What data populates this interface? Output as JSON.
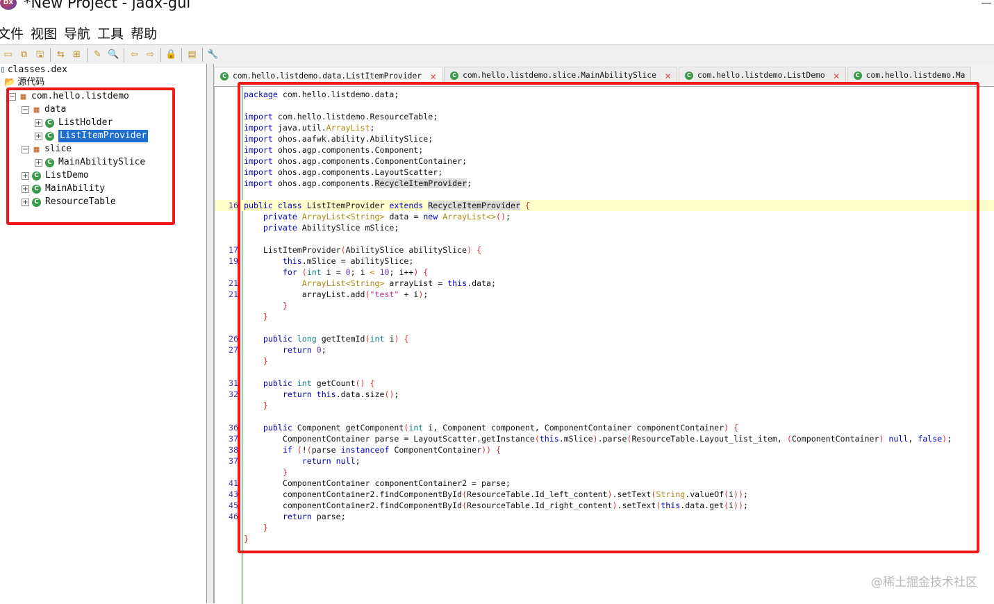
{
  "window": {
    "title": "*New Project - jadx-gui"
  },
  "menu": [
    "文件",
    "视图",
    "导航",
    "工具",
    "帮助"
  ],
  "toolbar": [
    "open-file-icon",
    "copy-icon",
    "save-all-icon",
    "sync-icon",
    "flatten-icon",
    "decompile-icon",
    "search-icon",
    "back-icon",
    "forward-icon",
    "deobfuscation-icon",
    "log-icon",
    "preferences-icon"
  ],
  "tree": {
    "root": "classes.dex",
    "source": "源代码",
    "nodes": [
      {
        "label": "com.hello.listdemo",
        "type": "package",
        "depth": 0,
        "expanded": true
      },
      {
        "label": "data",
        "type": "package",
        "depth": 1,
        "expanded": true
      },
      {
        "label": "ListHolder",
        "type": "class",
        "depth": 2
      },
      {
        "label": "ListItemProvider",
        "type": "class",
        "depth": 2,
        "selected": true
      },
      {
        "label": "slice",
        "type": "package",
        "depth": 1,
        "expanded": true
      },
      {
        "label": "MainAbilitySlice",
        "type": "class",
        "depth": 2
      },
      {
        "label": "ListDemo",
        "type": "class",
        "depth": 1
      },
      {
        "label": "MainAbility",
        "type": "class",
        "depth": 1
      },
      {
        "label": "ResourceTable",
        "type": "class",
        "depth": 1
      }
    ]
  },
  "tabs": [
    {
      "label": "com.hello.listdemo.data.ListItemProvider",
      "active": true
    },
    {
      "label": "com.hello.listdemo.slice.MainAbilitySlice"
    },
    {
      "label": "com.hello.listdemo.ListDemo"
    },
    {
      "label": "com.hello.listdemo.Ma"
    }
  ],
  "code": {
    "highlight_line": 10,
    "lines": [
      {
        "n": "",
        "t": "package com.hello.listdemo.data;"
      },
      {
        "n": "",
        "t": ""
      },
      {
        "n": "",
        "t": "import com.hello.listdemo.ResourceTable;"
      },
      {
        "n": "",
        "t": "import java.util.ArrayList;"
      },
      {
        "n": "",
        "t": "import ohos.aafwk.ability.AbilitySlice;"
      },
      {
        "n": "",
        "t": "import ohos.agp.components.Component;"
      },
      {
        "n": "",
        "t": "import ohos.agp.components.ComponentContainer;"
      },
      {
        "n": "",
        "t": "import ohos.agp.components.LayoutScatter;"
      },
      {
        "n": "",
        "t": "import ohos.agp.components.RecycleItemProvider;"
      },
      {
        "n": "",
        "t": ""
      },
      {
        "n": "16",
        "t": "public class ListItemProvider extends RecycleItemProvider {"
      },
      {
        "n": "",
        "t": "    private ArrayList<String> data = new ArrayList<>();"
      },
      {
        "n": "",
        "t": "    private AbilitySlice mSlice;"
      },
      {
        "n": "",
        "t": ""
      },
      {
        "n": "17",
        "t": "    ListItemProvider(AbilitySlice abilitySlice) {"
      },
      {
        "n": "19",
        "t": "        this.mSlice = abilitySlice;"
      },
      {
        "n": "",
        "t": "        for (int i = 0; i < 10; i++) {"
      },
      {
        "n": "21",
        "t": "            ArrayList<String> arrayList = this.data;"
      },
      {
        "n": "21",
        "t": "            arrayList.add(\"test\" + i);"
      },
      {
        "n": "",
        "t": "        }"
      },
      {
        "n": "",
        "t": "    }"
      },
      {
        "n": "",
        "t": ""
      },
      {
        "n": "26",
        "t": "    public long getItemId(int i) {"
      },
      {
        "n": "27",
        "t": "        return 0;"
      },
      {
        "n": "",
        "t": "    }"
      },
      {
        "n": "",
        "t": ""
      },
      {
        "n": "31",
        "t": "    public int getCount() {"
      },
      {
        "n": "32",
        "t": "        return this.data.size();"
      },
      {
        "n": "",
        "t": "    }"
      },
      {
        "n": "",
        "t": ""
      },
      {
        "n": "36",
        "t": "    public Component getComponent(int i, Component component, ComponentContainer componentContainer) {"
      },
      {
        "n": "37",
        "t": "        ComponentContainer parse = LayoutScatter.getInstance(this.mSlice).parse(ResourceTable.Layout_list_item, (ComponentContainer) null, false);"
      },
      {
        "n": "38",
        "t": "        if (!(parse instanceof ComponentContainer)) {"
      },
      {
        "n": "37",
        "t": "            return null;"
      },
      {
        "n": "",
        "t": "        }"
      },
      {
        "n": "41",
        "t": "        ComponentContainer componentContainer2 = parse;"
      },
      {
        "n": "43",
        "t": "        componentContainer2.findComponentById(ResourceTable.Id_left_content).setText(String.valueOf(i));"
      },
      {
        "n": "45",
        "t": "        componentContainer2.findComponentById(ResourceTable.Id_right_content).setText(this.data.get(i));"
      },
      {
        "n": "46",
        "t": "        return parse;"
      },
      {
        "n": "",
        "t": "    }"
      },
      {
        "n": "",
        "t": "}"
      }
    ]
  },
  "watermark": "@稀土掘金技术社区",
  "colors": {
    "keyword": "#0000c0",
    "type": "#108080",
    "class": "#b08a10",
    "annotation": "#f01818",
    "selection": "#1f6fd0"
  }
}
